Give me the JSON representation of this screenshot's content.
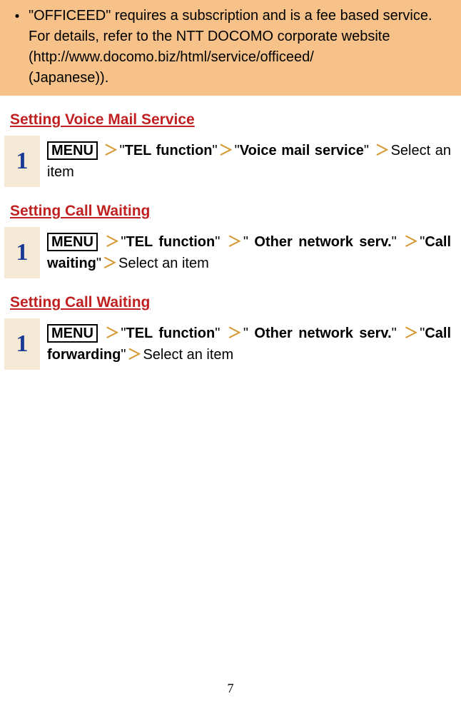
{
  "note": {
    "bullet": "・",
    "line1": "\"OFFICEED\" requires a subscription and is a fee based service.",
    "line2": "For details, refer to the NTT DOCOMO corporate website",
    "url": "(http://www.docomo.biz/html/service/officeed/",
    "line3": "(Japanese))."
  },
  "sections": {
    "voicemail": {
      "title": "Setting Voice Mail Service",
      "step_num": "1",
      "menu": "MENU",
      "chev": "＞",
      "q": "\"",
      "tel_function": "TEL function",
      "voice_mail": "Voice mail service",
      "select": "Select an item"
    },
    "callwaiting": {
      "title": "Setting Call Waiting",
      "step_num": "1",
      "menu": "MENU",
      "chev": "＞",
      "q": "\"",
      "tel_function": "TEL function",
      "other_network": " Other network serv.",
      "call_waiting": "Call waiting",
      "select": "Select an item"
    },
    "callforwarding": {
      "title": "Setting Call Waiting",
      "step_num": "1",
      "menu": "MENU",
      "chev": "＞",
      "q": "\"",
      "tel_function": "TEL function",
      "other_network": " Other network serv.",
      "call_forwarding": "Call forwarding",
      "select": "Select an item"
    }
  },
  "page_number": "7"
}
